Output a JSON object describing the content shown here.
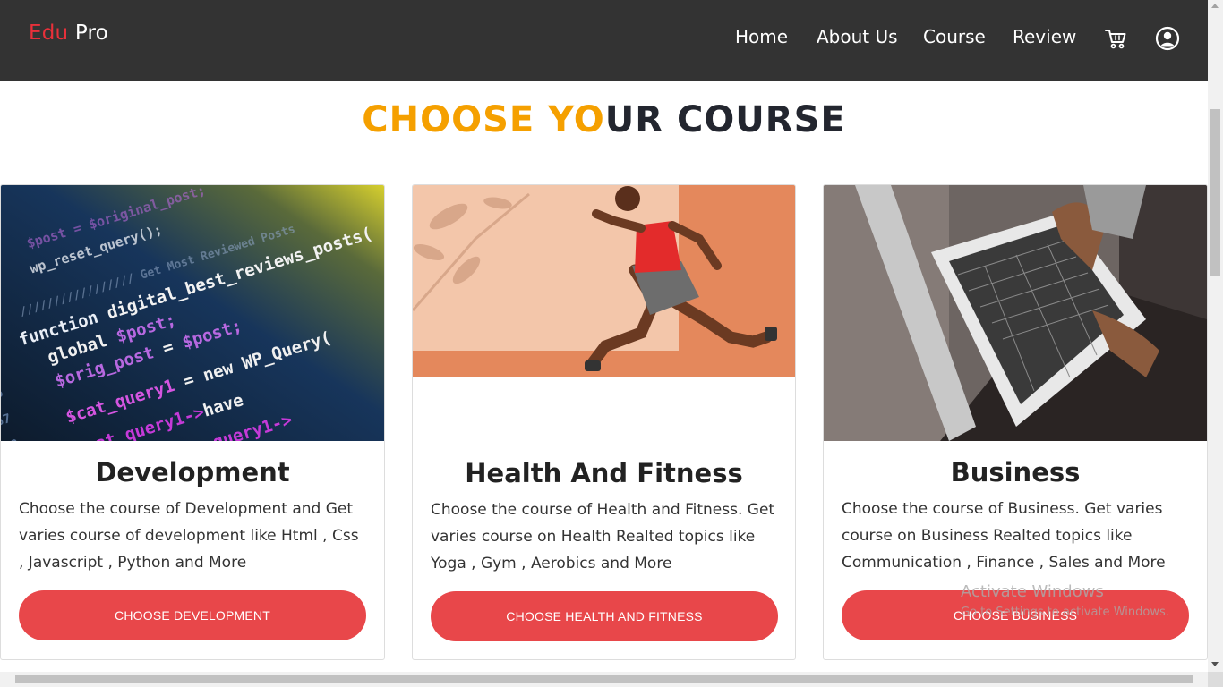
{
  "navbar": {
    "logo": {
      "part1": "Edu",
      "part2": "Pro"
    },
    "links": [
      {
        "label": "Home"
      },
      {
        "label": "About Us"
      },
      {
        "label": "Course"
      },
      {
        "label": "Review"
      }
    ],
    "icons": [
      "cart-icon",
      "user-account-icon"
    ]
  },
  "section": {
    "title_accent": "CHOOSE YO",
    "title_rest": "UR COURSE"
  },
  "cards": [
    {
      "image": "code-editor-photo",
      "title": "Development",
      "description": "Choose the course of Development and Get varies course of development like Html , Css , Javascript , Python and More",
      "button": "CHOOSE DEVELOPMENT"
    },
    {
      "image": "running-athlete-photo",
      "title": "Health And Fitness",
      "description": "Choose the course of Health and Fitness. Get varies course on Health Realted topics like Yoga , Gym , Aerobics and More",
      "button": "CHOOSE HEALTH AND FITNESS"
    },
    {
      "image": "laptop-hands-photo",
      "title": "Business",
      "description": "Choose the course of Business. Get varies course on Business Realted topics like Communication , Finance , Sales and More",
      "button": "CHOOSE BUSINESS"
    }
  ],
  "watermark": {
    "title": "Activate Windows",
    "subtitle": "Go to Settings to activate Windows."
  },
  "colors": {
    "navbar_bg": "#333333",
    "logo_accent": "#e8303a",
    "title_accent": "#f5a000",
    "title_dark": "#23262f",
    "button": "#e8474a"
  }
}
